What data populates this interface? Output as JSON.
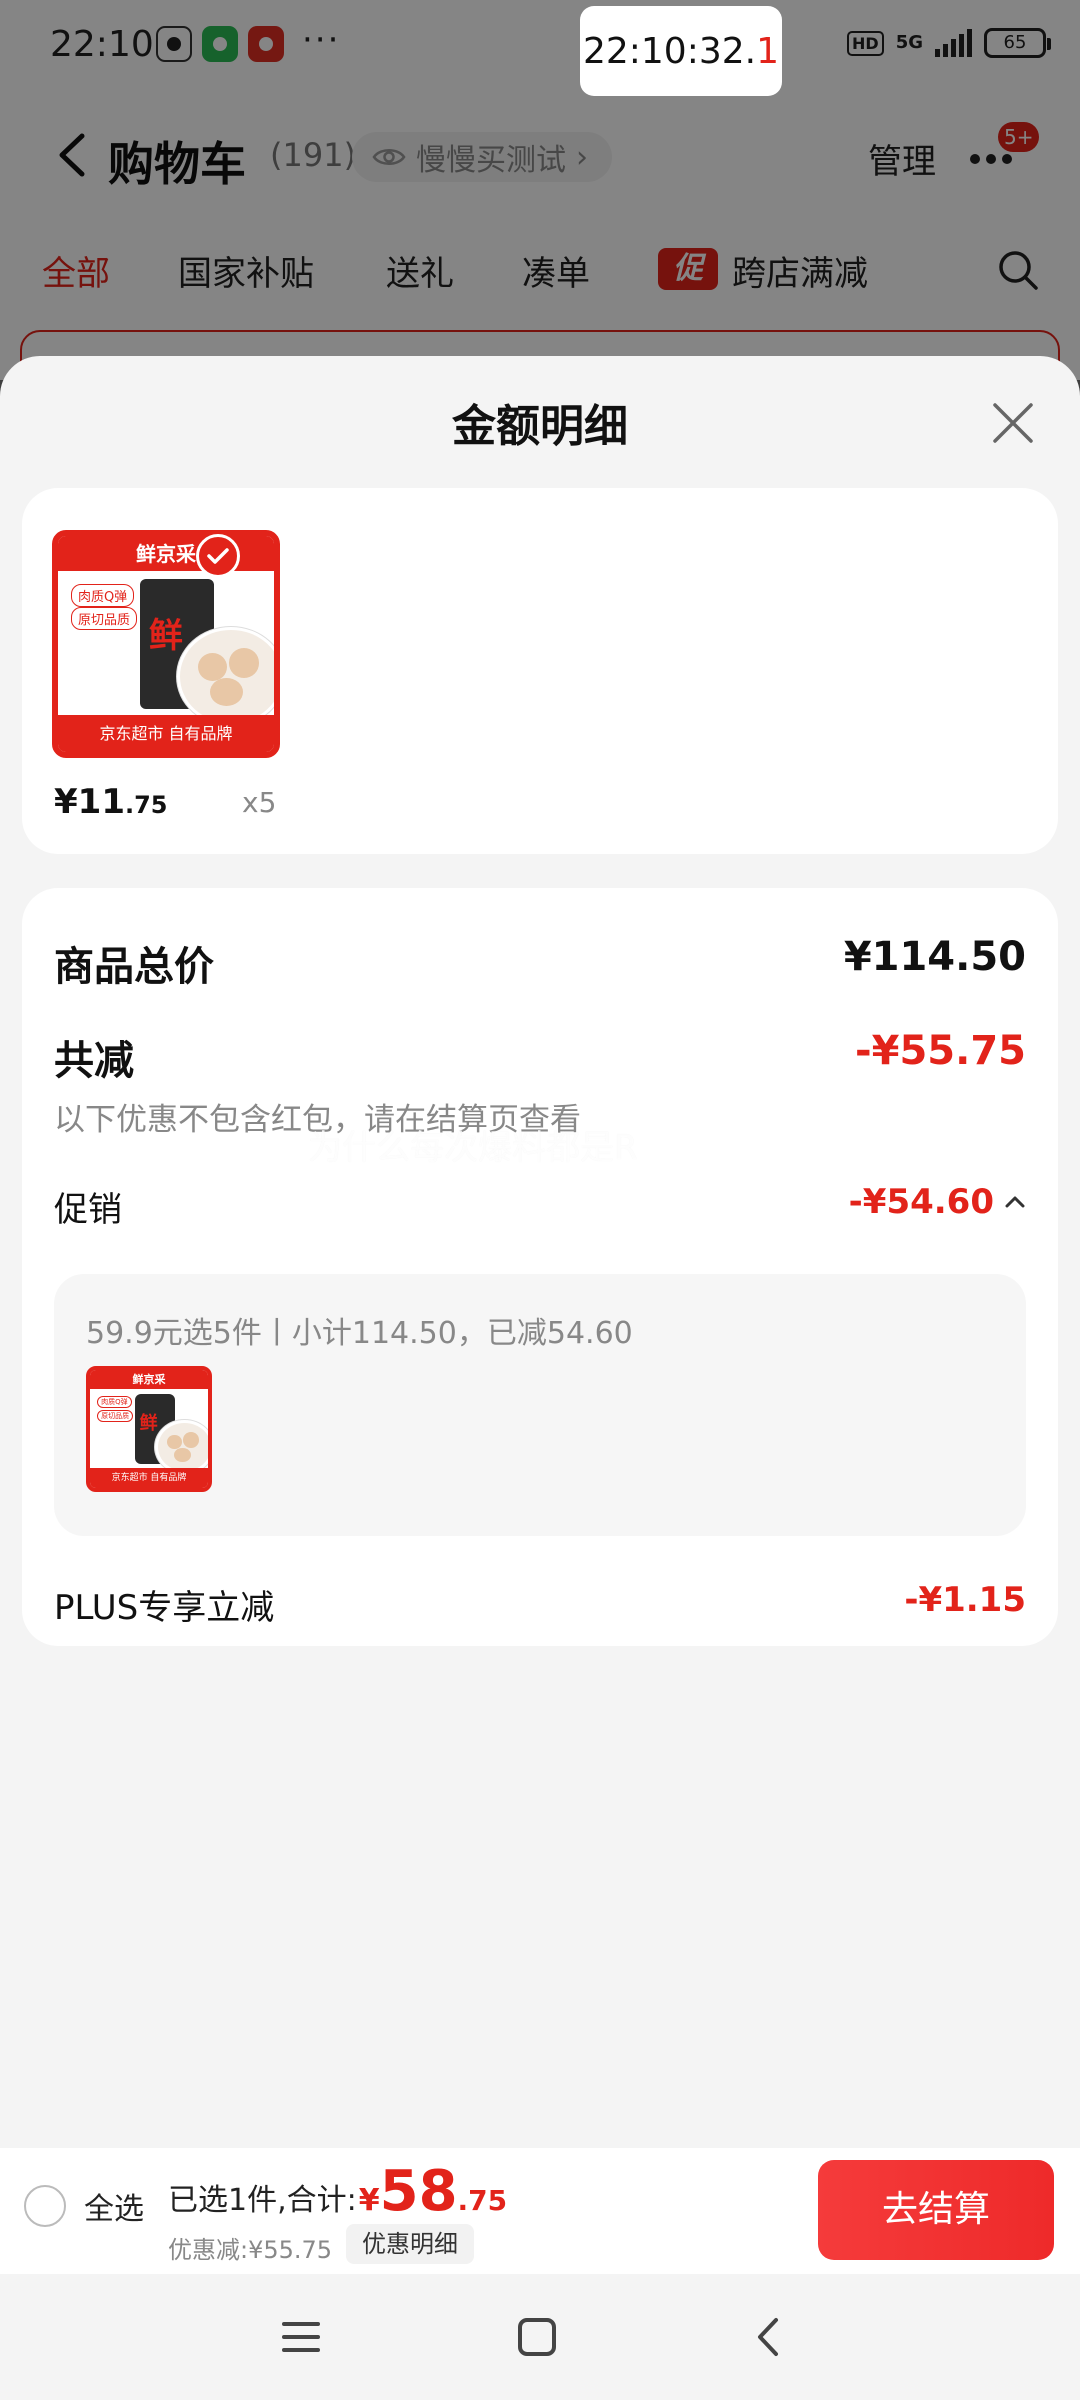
{
  "status_bar": {
    "time": "22:10",
    "more": "···",
    "hd": "HD",
    "network": "5G",
    "battery": "65"
  },
  "time_overlay": {
    "main": "22:10:32.",
    "last_digit": "1"
  },
  "nav": {
    "title": "购物车",
    "count": "(191)",
    "test_label": "慢慢买测试",
    "test_chevron": "›",
    "manage": "管理",
    "badge": "5+"
  },
  "tabs": [
    {
      "label": "全部",
      "active": true
    },
    {
      "label": "国家补贴"
    },
    {
      "label": "送礼"
    },
    {
      "label": "凑单"
    },
    {
      "label": "跨店满减"
    }
  ],
  "promo_tag": "促",
  "sheet": {
    "title": "金额明细"
  },
  "product": {
    "brand": "鲜京采",
    "pack_char": "鲜",
    "chip_1": "肉质Q弹",
    "chip_2": "原切品质",
    "footer": "京东超市 自有品牌",
    "price_int": "¥11",
    "price_dec": ".75",
    "qty": "x5"
  },
  "detail": {
    "total_label": "商品总价",
    "total_value": "¥114.50",
    "discount_label": "共减",
    "discount_value": "-¥55.75",
    "discount_note": "以下优惠不包含红包，请在结算页查看",
    "watermark": "为什么每次爆料都是R",
    "promo_label": "促销",
    "promo_value": "-¥54.60",
    "promo_summary": "59.9元选5件丨小计114.50，已减54.60",
    "plus_label": "PLUS专享立减",
    "plus_value": "-¥1.15"
  },
  "checkout": {
    "select_all": "全选",
    "selected_text": "已选1件,合计:",
    "yen": "¥",
    "total_int": "58",
    "total_dec": ".75",
    "saved": "优惠减:¥55.75",
    "detail_button": "优惠明细",
    "checkout_button": "去结算"
  },
  "colors": {
    "accent": "#e2231a",
    "sheet_bg": "#f4f4f4"
  }
}
